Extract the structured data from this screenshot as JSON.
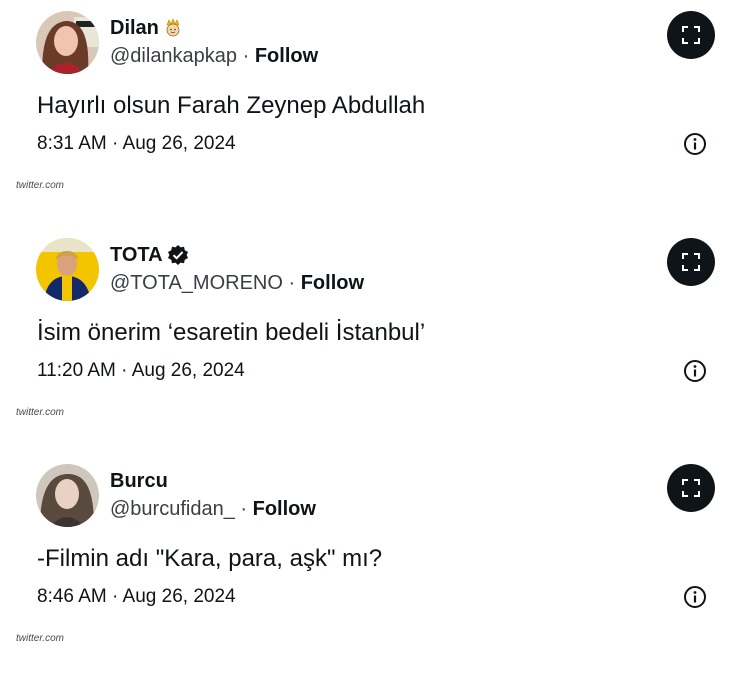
{
  "tweets": [
    {
      "name": "Dilan",
      "name_emoji": "princess-emoji",
      "handle": "@dilankapkap",
      "separator": "·",
      "follow_label": "Follow",
      "text": "Hayırlı olsun Farah Zeynep Abdullah",
      "timestamp": "8:31 AM · Aug 26, 2024",
      "source": "twitter.com"
    },
    {
      "name": "TOTA",
      "verified": true,
      "handle": "@TOTA_MORENO",
      "separator": "·",
      "follow_label": "Follow",
      "text": "İsim önerim ‘esaretin bedeli İstanbul’",
      "timestamp": "11:20 AM · Aug 26, 2024",
      "source": "twitter.com"
    },
    {
      "name": "Burcu",
      "handle": "@burcufidan_",
      "separator": "·",
      "follow_label": "Follow",
      "text": "-Filmin adı \"Kara, para, aşk\" mı?",
      "timestamp": "8:46 AM · Aug 26, 2024",
      "source": "twitter.com"
    }
  ],
  "icons": {
    "expand": "expand-icon",
    "info": "info-icon",
    "verified": "verified-badge-icon"
  },
  "colors": {
    "text": "#0f1419",
    "expand_button_bg": "#0f1419",
    "avatar_tota_bg": "#f2c500"
  }
}
